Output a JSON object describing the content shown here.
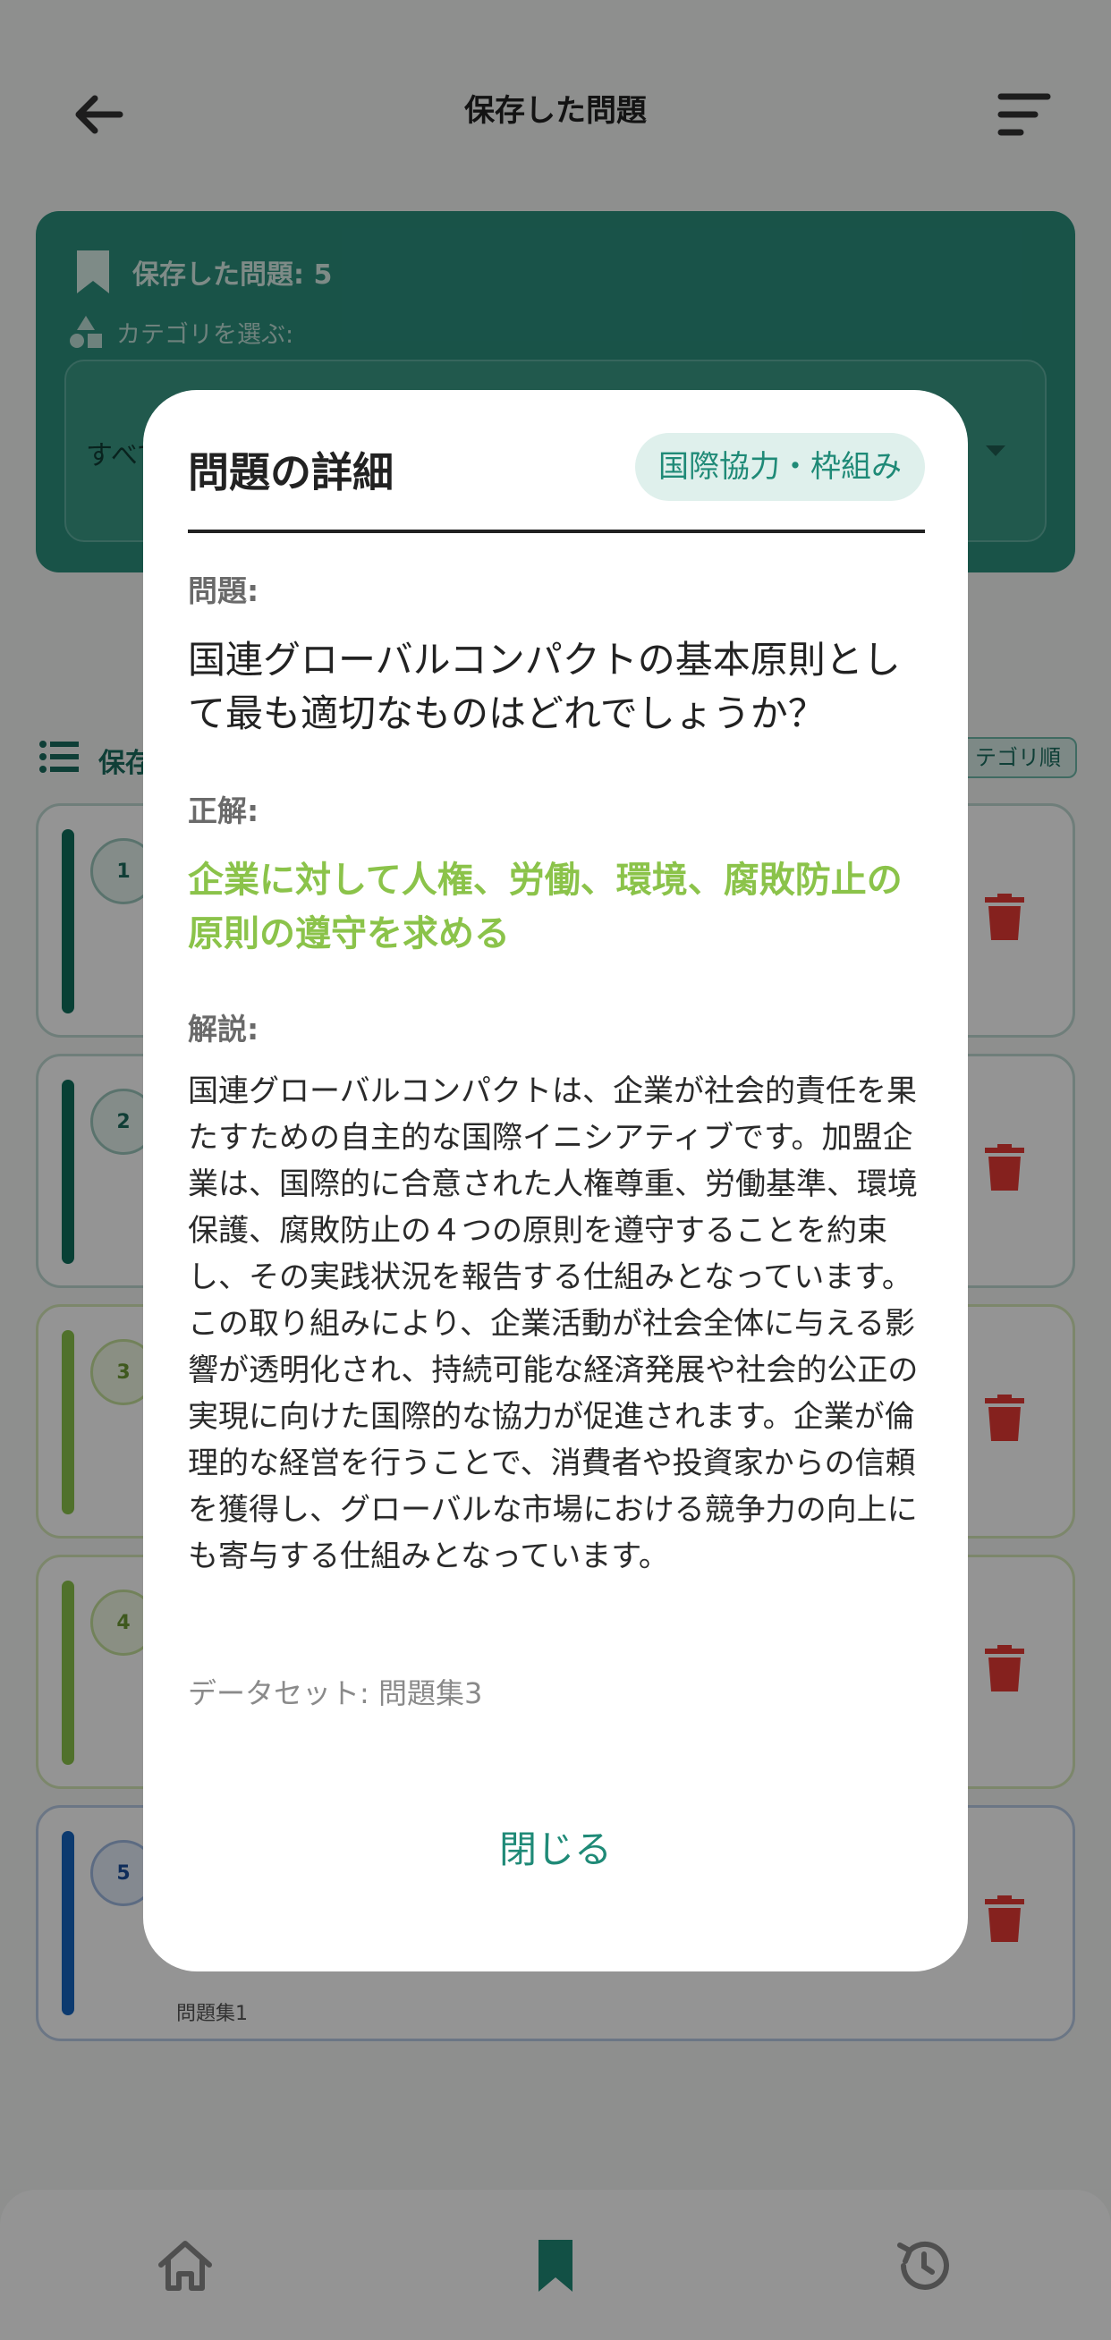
{
  "app_bar": {
    "title": "保存した問題"
  },
  "summary": {
    "count_text": "保存した問題: 5",
    "category_label": "カテゴリを選ぶ:",
    "dropdown_value": "すべて"
  },
  "list": {
    "header": "保存",
    "sort_chip": "テゴリ順",
    "items": [
      {
        "num": "1",
        "color": "#0f6e5c"
      },
      {
        "num": "2",
        "color": "#0f6e5c"
      },
      {
        "num": "3",
        "color": "#8bc34a"
      },
      {
        "num": "4",
        "color": "#8bc34a"
      },
      {
        "num": "5",
        "color": "#1565c0",
        "source": "問題集1"
      }
    ]
  },
  "dialog": {
    "title": "問題の詳細",
    "badge": "国際協力・枠組み",
    "question_label": "問題:",
    "question": "国連グローバルコンパクトの基本原則として最も適切なものはどれでしょうか？",
    "answer_label": "正解:",
    "answer": "企業に対して人権、労働、環境、腐敗防止の原則の遵守を求める",
    "explanation_label": "解説:",
    "explanation": "国連グローバルコンパクトは、企業が社会的責任を果たすための自主的な国際イニシアティブです。加盟企業は、国際的に合意された人権尊重、労働基準、環境保護、腐敗防止の４つの原則を遵守することを約束し、その実践状況を報告する仕組みとなっています。この取り組みにより、企業活動が社会全体に与える影響が透明化され、持続可能な経済発展や社会的公正の実現に向けた国際的な協力が促進されます。企業が倫理的な経営を行うことで、消費者や投資家からの信頼を獲得し、グローバルな市場における競争力の向上にも寄与する仕組みとなっています。",
    "dataset": "データセット: 問題集3",
    "close_label": "閉じる"
  },
  "colors": {
    "accent": "#1f8a77",
    "answer": "#8bc34a",
    "trash": "#e53935"
  },
  "icons": [
    "back-arrow-icon",
    "sort-icon",
    "bookmark-icon",
    "category-icon",
    "list-icon",
    "trash-icon",
    "home-icon",
    "history-icon"
  ]
}
